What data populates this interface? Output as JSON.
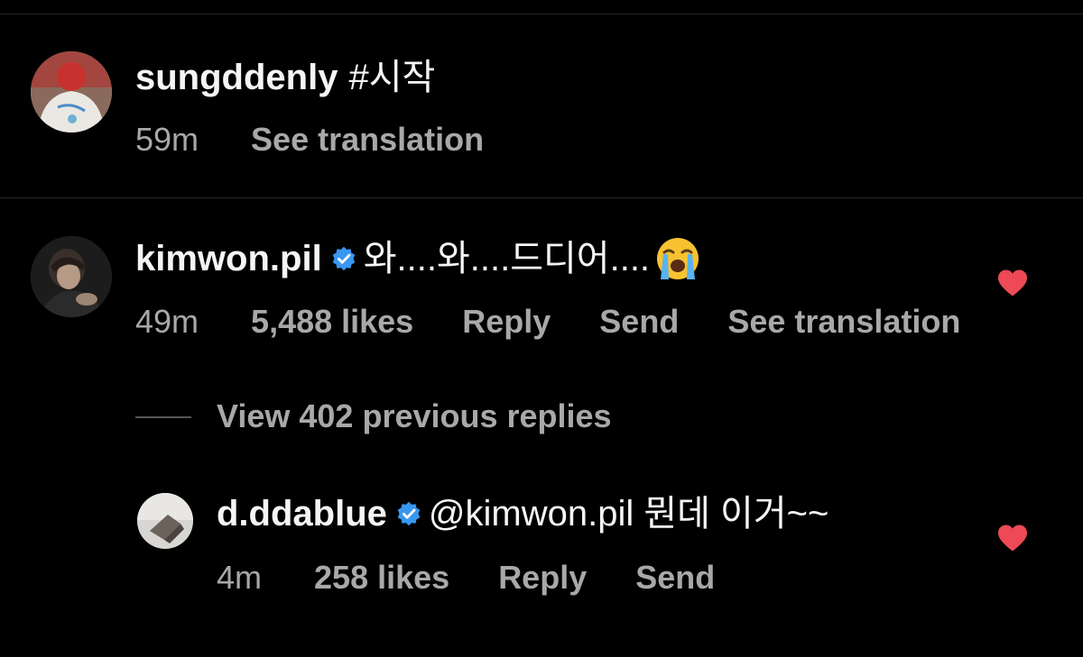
{
  "post": {
    "username": "sungddenly",
    "caption": "#시작",
    "time": "59m",
    "see_translation": "See translation"
  },
  "comments": [
    {
      "username": "kimwon.pil",
      "verified": true,
      "text": "와....와....드디어....",
      "emoji": "loudly-crying-face",
      "time": "49m",
      "likes": "5,488 likes",
      "reply": "Reply",
      "send": "Send",
      "see_translation": "See translation",
      "liked": true
    }
  ],
  "view_replies": "View 402 previous replies",
  "replies": [
    {
      "username": "d.ddablue",
      "verified": true,
      "text": "@kimwon.pil 뭔데 이거~~",
      "time": "4m",
      "likes": "258 likes",
      "reply": "Reply",
      "send": "Send",
      "liked": true
    }
  ],
  "colors": {
    "background": "#000000",
    "text": "#f5f5f5",
    "secondary": "#a8a8a8",
    "verified": "#3897f0",
    "heart": "#ed4956"
  }
}
